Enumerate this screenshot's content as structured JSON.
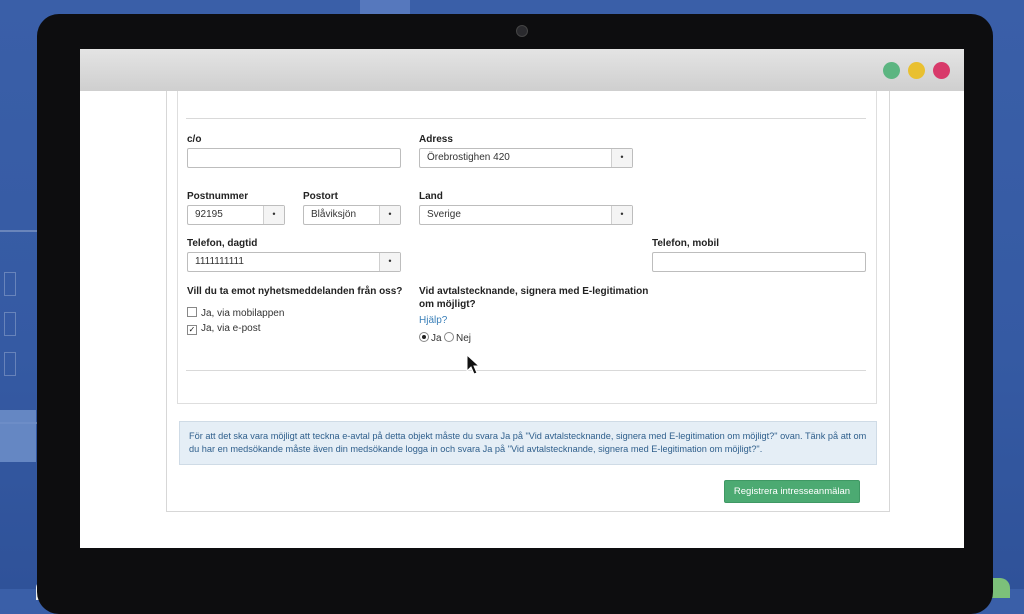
{
  "form": {
    "co_label": "c/o",
    "co_value": "",
    "address_label": "Adress",
    "address_value": "Örebrostighen 420",
    "postal_code_label": "Postnummer",
    "postal_code_value": "92195",
    "city_label": "Postort",
    "city_value": "Blåviksjön",
    "country_label": "Land",
    "country_value": "Sverige",
    "phone_day_label": "Telefon, dagtid",
    "phone_day_value": "1111111111",
    "phone_mobile_label": "Telefon, mobil",
    "phone_mobile_value": "",
    "newsletter_question": "Vill du ta emot nyhetsmeddelanden från oss?",
    "newsletter_options": [
      {
        "label": "Ja, via mobilappen",
        "checked": false
      },
      {
        "label": "Ja, via e-post",
        "checked": true
      }
    ],
    "esign_question_line1": "Vid avtalstecknande, signera med E-legitimation",
    "esign_question_line2": "om möjligt?",
    "help_link": "Hjälp?",
    "esign_options": [
      {
        "label": "Ja",
        "selected": true
      },
      {
        "label": "Nej",
        "selected": false
      }
    ],
    "field_button_glyph": "•"
  },
  "info_text": "För att det ska vara möjligt att teckna e-avtal på detta objekt måste du svara Ja på \"Vid avtalstecknande, signera med E-legitimation om möjligt?\" ovan. Tänk på att om du har en medsökande måste även din medsökande logga in och svara Ja på \"Vid avtalstecknande, signera med E-legitimation om möjligt?\".",
  "submit_label": "Registrera intresseanmälan",
  "colors": {
    "window_close": "#d83a6a",
    "window_minimize": "#e9c030",
    "window_maximize": "#5cb581",
    "submit_button": "#4caa72",
    "info_background": "#e5eef6"
  },
  "icons": {
    "cursor": "arrow-cursor-icon",
    "field_button": "dot-icon"
  }
}
